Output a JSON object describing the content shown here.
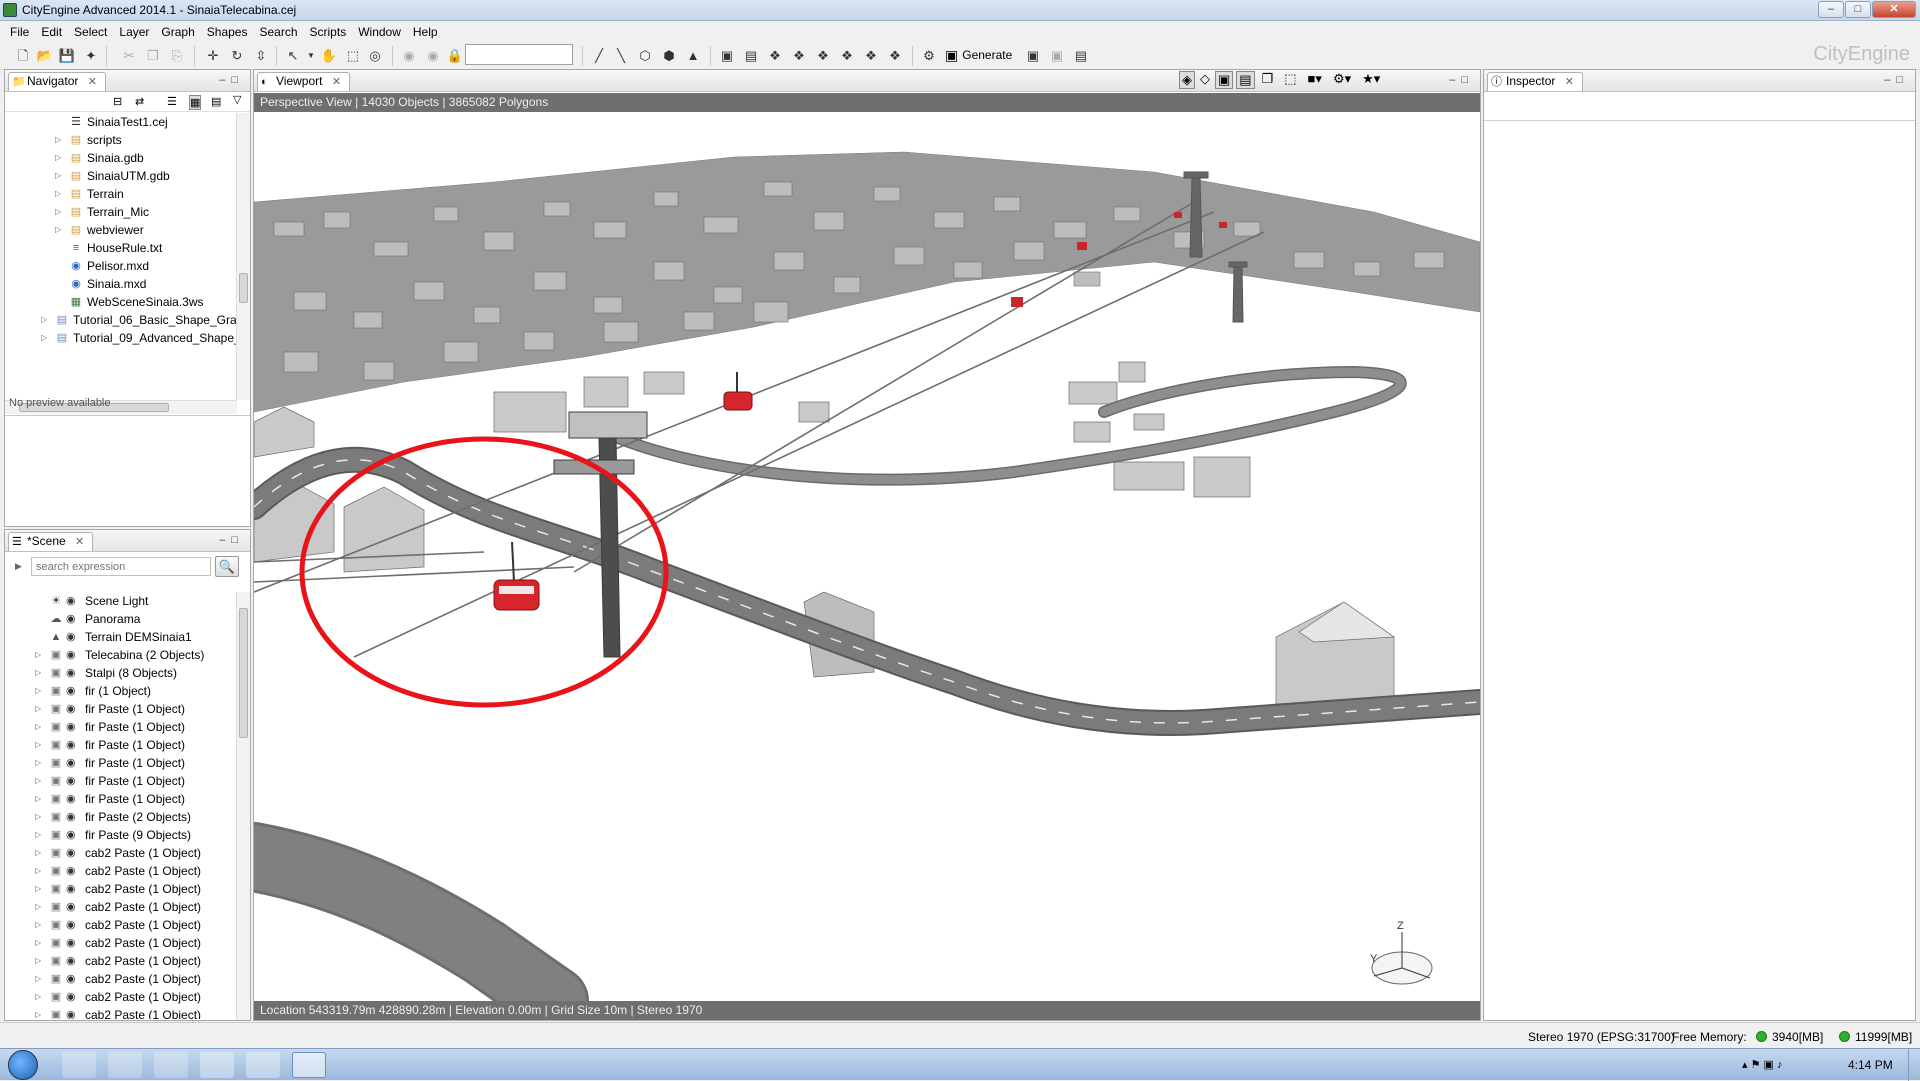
{
  "window": {
    "title": "CityEngine Advanced 2014.1 - SinaiaTelecabina.cej",
    "minimize": "–",
    "maximize": "□",
    "close": "✕"
  },
  "menu": [
    "File",
    "Edit",
    "Select",
    "Layer",
    "Graph",
    "Shapes",
    "Search",
    "Scripts",
    "Window",
    "Help"
  ],
  "toolbar": {
    "generate_label": "Generate",
    "brand": "CityEngine"
  },
  "navigator": {
    "tab": "Navigator",
    "items": [
      {
        "label": "SinaiaTest1.cej",
        "icon": "cej-file-icon",
        "expandable": false
      },
      {
        "label": "scripts",
        "icon": "folder-icon",
        "expandable": true
      },
      {
        "label": "Sinaia.gdb",
        "icon": "folder-icon",
        "expandable": true
      },
      {
        "label": "SinaiaUTM.gdb",
        "icon": "folder-icon",
        "expandable": true
      },
      {
        "label": "Terrain",
        "icon": "folder-icon",
        "expandable": true
      },
      {
        "label": "Terrain_Mic",
        "icon": "folder-icon",
        "expandable": true
      },
      {
        "label": "webviewer",
        "icon": "folder-icon",
        "expandable": true
      },
      {
        "label": "HouseRule.txt",
        "icon": "text-file-icon",
        "expandable": false
      },
      {
        "label": "Pelisor.mxd",
        "icon": "mxd-file-icon",
        "expandable": false
      },
      {
        "label": "Sinaia.mxd",
        "icon": "mxd-file-icon",
        "expandable": false
      },
      {
        "label": "WebSceneSinaia.3ws",
        "icon": "webscene-file-icon",
        "expandable": false
      },
      {
        "label": "Tutorial_06_Basic_Shape_Grammar",
        "icon": "project-icon",
        "expandable": true,
        "root": true
      },
      {
        "label": "Tutorial_09_Advanced_Shape_Gram",
        "icon": "project-icon",
        "expandable": true,
        "root": true
      }
    ],
    "preview_text": "No preview available"
  },
  "scene": {
    "tab": "*Scene",
    "search_placeholder": "search expression",
    "items": [
      {
        "label": "Scene Light",
        "icon": "light-icon",
        "expandable": false
      },
      {
        "label": "Panorama",
        "icon": "panorama-icon",
        "expandable": false
      },
      {
        "label": "Terrain DEMSinaia1",
        "icon": "terrain-icon",
        "expandable": false
      },
      {
        "label": "Telecabina (2 Objects)",
        "icon": "layer-icon",
        "expandable": true
      },
      {
        "label": "Stalpi (8 Objects)",
        "icon": "layer-icon",
        "expandable": true
      },
      {
        "label": "fir (1 Object)",
        "icon": "layer-icon",
        "expandable": true
      },
      {
        "label": "fir Paste (1 Object)",
        "icon": "layer-icon",
        "expandable": true
      },
      {
        "label": "fir Paste (1 Object)",
        "icon": "layer-icon",
        "expandable": true
      },
      {
        "label": "fir Paste (1 Object)",
        "icon": "layer-icon",
        "expandable": true
      },
      {
        "label": "fir Paste (1 Object)",
        "icon": "layer-icon",
        "expandable": true
      },
      {
        "label": "fir Paste (1 Object)",
        "icon": "layer-icon",
        "expandable": true
      },
      {
        "label": "fir Paste (1 Object)",
        "icon": "layer-icon",
        "expandable": true
      },
      {
        "label": "fir Paste (2 Objects)",
        "icon": "layer-icon",
        "expandable": true
      },
      {
        "label": "fir Paste (9 Objects)",
        "icon": "layer-icon",
        "expandable": true
      },
      {
        "label": "cab2 Paste (1 Object)",
        "icon": "layer-icon",
        "expandable": true
      },
      {
        "label": "cab2 Paste (1 Object)",
        "icon": "layer-icon",
        "expandable": true
      },
      {
        "label": "cab2 Paste (1 Object)",
        "icon": "layer-icon",
        "expandable": true
      },
      {
        "label": "cab2 Paste (1 Object)",
        "icon": "layer-icon",
        "expandable": true
      },
      {
        "label": "cab2 Paste (1 Object)",
        "icon": "layer-icon",
        "expandable": true
      },
      {
        "label": "cab2 Paste (1 Object)",
        "icon": "layer-icon",
        "expandable": true
      },
      {
        "label": "cab2 Paste (1 Object)",
        "icon": "layer-icon",
        "expandable": true
      },
      {
        "label": "cab2 Paste (1 Object)",
        "icon": "layer-icon",
        "expandable": true
      },
      {
        "label": "cab2 Paste (1 Object)",
        "icon": "layer-icon",
        "expandable": true
      },
      {
        "label": "cab2 Paste (1 Object)",
        "icon": "layer-icon",
        "expandable": true
      }
    ]
  },
  "viewport": {
    "tab": "Viewport",
    "header": "Perspective View   |  14030 Objects   |  3865082 Polygons",
    "footer": "Location 543319.79m 428890.28m   |  Elevation 0.00m   |  Grid Size 10m   |  Stereo 1970",
    "axis_z": "Z",
    "axis_y": "Y",
    "highlight_color": "#e8141a",
    "cable_car_color": "#d7262b"
  },
  "inspector": {
    "tab": "Inspector"
  },
  "statusbar": {
    "crs": "Stereo 1970 (EPSG:31700)",
    "free_memory_label": "Free Memory:",
    "mem1": "3940[MB]",
    "mem2": "11999[MB]"
  },
  "taskbar": {
    "time": "4:14 PM"
  }
}
